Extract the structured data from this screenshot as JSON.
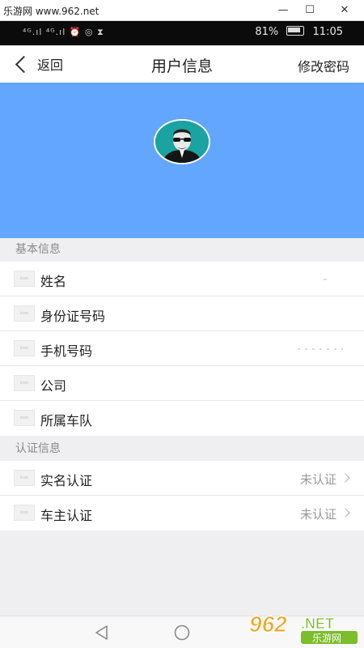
{
  "window": {
    "title": "乐游网 www.962.net",
    "minimize": "—",
    "maximize": "☐",
    "close": "✕"
  },
  "status_bar": {
    "signal_text": "⁴ᴳ.ıl ⁴ᴳ.ıl ⏰ ◎ ⧗",
    "battery_percent": "81%",
    "time": "11:05"
  },
  "nav": {
    "back_label": "返回",
    "title": "用户信息",
    "right_action": "修改密码"
  },
  "profile": {
    "banner_color": "#62a6ff"
  },
  "sections": {
    "basic": {
      "title": "基本信息",
      "rows": [
        {
          "icon_text": "icon",
          "label": "姓名"
        },
        {
          "icon_text": "icon",
          "label": "身份证号码"
        },
        {
          "icon_text": "icon",
          "label": "手机号码"
        },
        {
          "icon_text": "icon",
          "label": "公司"
        },
        {
          "icon_text": "icon",
          "label": "所属车队"
        }
      ]
    },
    "auth": {
      "title": "认证信息",
      "rows": [
        {
          "icon_text": "icon",
          "label": "实名认证",
          "value": "未认证"
        },
        {
          "icon_text": "icon",
          "label": "车主认证",
          "value": "未认证"
        }
      ]
    }
  },
  "watermark": {
    "number": "962",
    "suffix": ".NET",
    "name": "乐游网"
  }
}
